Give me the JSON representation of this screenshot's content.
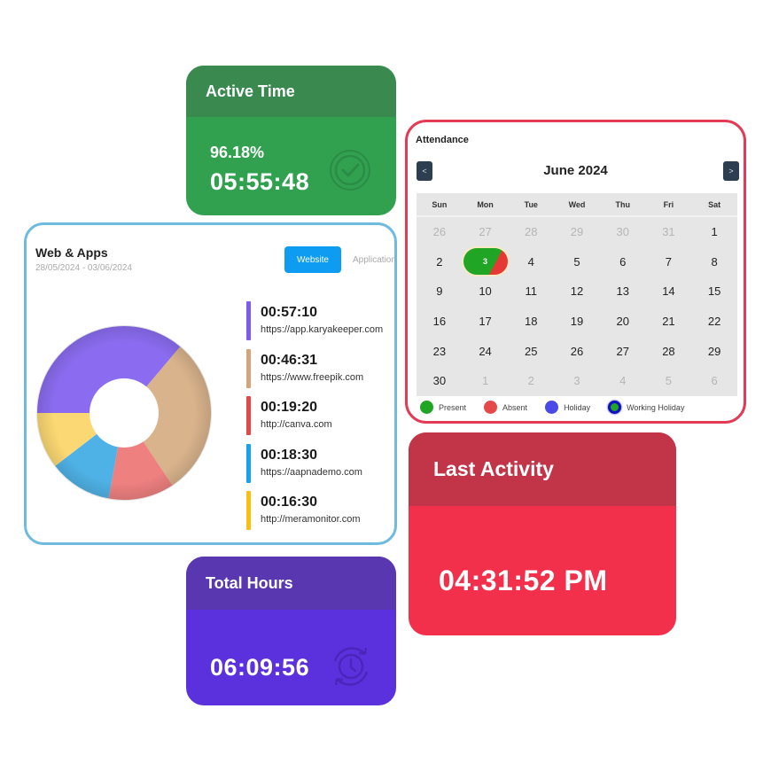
{
  "active_time": {
    "title": "Active Time",
    "percent": "96.18%",
    "time": "05:55:48",
    "icon": "clock-check-icon",
    "colors": {
      "header": "#3a8a50",
      "body": "#31a14f"
    }
  },
  "total_hours": {
    "title": "Total Hours",
    "time": "06:09:56",
    "icon": "clock-refresh-icon",
    "colors": {
      "header": "#5837b0",
      "body": "#5a31dd"
    }
  },
  "last_activity": {
    "title": "Last Activity",
    "time": "04:31:52 PM",
    "colors": {
      "header": "#c23447",
      "body": "#f2304b"
    }
  },
  "web_apps": {
    "title": "Web & Apps",
    "date_range": "28/05/2024 - 03/06/2024",
    "tabs": [
      {
        "label": "Website",
        "active": true
      },
      {
        "label": "Application",
        "active": false
      }
    ],
    "sites": [
      {
        "duration": "00:57:10",
        "url": "https://app.karyakeeper.com",
        "color": "#8b6cf0"
      },
      {
        "duration": "00:46:31",
        "url": "https://www.freepik.com",
        "color": "#d9b38c"
      },
      {
        "duration": "00:19:20",
        "url": "http://canva.com",
        "color": "#ee8080"
      },
      {
        "duration": "00:18:30",
        "url": "https://aapnademo.com",
        "color": "#4fb2e6"
      },
      {
        "duration": "00:16:30",
        "url": "http://meramonitor.com",
        "color": "#fbd873"
      }
    ]
  },
  "chart_data": {
    "type": "pie",
    "variant": "donut",
    "title": "",
    "categories": [
      "https://app.karyakeeper.com",
      "https://www.freepik.com",
      "http://canva.com",
      "https://aapnademo.com",
      "http://meramonitor.com"
    ],
    "values_seconds": [
      3430,
      2791,
      1160,
      1110,
      990
    ],
    "colors": [
      "#8b6cf0",
      "#d9b38c",
      "#ee8080",
      "#4fb2e6",
      "#fbd873"
    ],
    "start_angle_deg": 270,
    "direction": "clockwise",
    "legend": "right"
  },
  "bar_colors": [
    "#7f5af0",
    "#d4a57a",
    "#e34848",
    "#17a2f0",
    "#fbbf14"
  ],
  "attendance": {
    "title": "Attendance",
    "month": "June 2024",
    "prev_label": "<",
    "next_label": ">",
    "weekdays": [
      "Sun",
      "Mon",
      "Tue",
      "Wed",
      "Thu",
      "Fri",
      "Sat"
    ],
    "weeks": [
      [
        {
          "d": "26",
          "m": true
        },
        {
          "d": "27",
          "m": true
        },
        {
          "d": "28",
          "m": true
        },
        {
          "d": "29",
          "m": true
        },
        {
          "d": "30",
          "m": true
        },
        {
          "d": "31",
          "m": true
        },
        {
          "d": "1"
        }
      ],
      [
        {
          "d": "2"
        },
        {
          "d": "3",
          "status": "present-absent"
        },
        {
          "d": "4"
        },
        {
          "d": "5"
        },
        {
          "d": "6"
        },
        {
          "d": "7"
        },
        {
          "d": "8"
        }
      ],
      [
        {
          "d": "9"
        },
        {
          "d": "10"
        },
        {
          "d": "11"
        },
        {
          "d": "12"
        },
        {
          "d": "13"
        },
        {
          "d": "14"
        },
        {
          "d": "15"
        }
      ],
      [
        {
          "d": "16"
        },
        {
          "d": "17"
        },
        {
          "d": "18"
        },
        {
          "d": "19"
        },
        {
          "d": "20"
        },
        {
          "d": "21"
        },
        {
          "d": "22"
        }
      ],
      [
        {
          "d": "23"
        },
        {
          "d": "24"
        },
        {
          "d": "25"
        },
        {
          "d": "26"
        },
        {
          "d": "27"
        },
        {
          "d": "28"
        },
        {
          "d": "29"
        }
      ],
      [
        {
          "d": "30"
        },
        {
          "d": "1",
          "m": true
        },
        {
          "d": "2",
          "m": true
        },
        {
          "d": "3",
          "m": true
        },
        {
          "d": "4",
          "m": true
        },
        {
          "d": "5",
          "m": true
        },
        {
          "d": "6",
          "m": true
        }
      ]
    ],
    "legend": [
      {
        "label": "Present",
        "color": "#20a524"
      },
      {
        "label": "Absent",
        "color": "#e44a4a"
      },
      {
        "label": "Holiday",
        "color": "#4a4ae8"
      },
      {
        "label": "Working Holiday",
        "color": "#20a524",
        "ring": "#1010c0"
      }
    ]
  }
}
